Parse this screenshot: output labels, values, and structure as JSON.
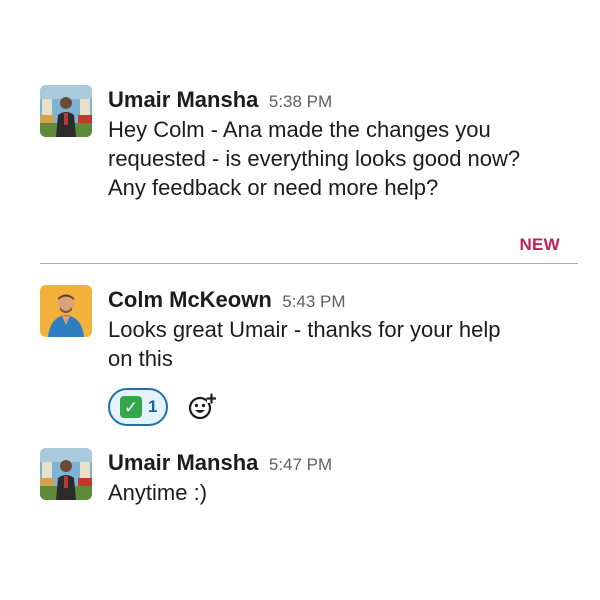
{
  "messages": [
    {
      "sender": "Umair Mansha",
      "time": "5:38 PM",
      "avatar_icon": "user-avatar-umair",
      "lines": [
        "Hey Colm - Ana made the changes you",
        "requested - is everything looks good now?",
        "Any feedback or need more help?"
      ]
    },
    {
      "sender": "Colm McKeown",
      "time": "5:43 PM",
      "avatar_icon": "user-avatar-colm",
      "lines": [
        "Looks great Umair - thanks for your help",
        "on this"
      ],
      "reactions": [
        {
          "emoji": "white-check-mark-icon",
          "count": "1",
          "selected": true
        }
      ]
    },
    {
      "sender": "Umair Mansha",
      "time": "5:47 PM",
      "avatar_icon": "user-avatar-umair",
      "lines": [
        "Anytime :)"
      ]
    }
  ],
  "divider": {
    "label": "NEW",
    "color": "#c0234e"
  },
  "add_reaction_icon": "add-emoji-icon"
}
